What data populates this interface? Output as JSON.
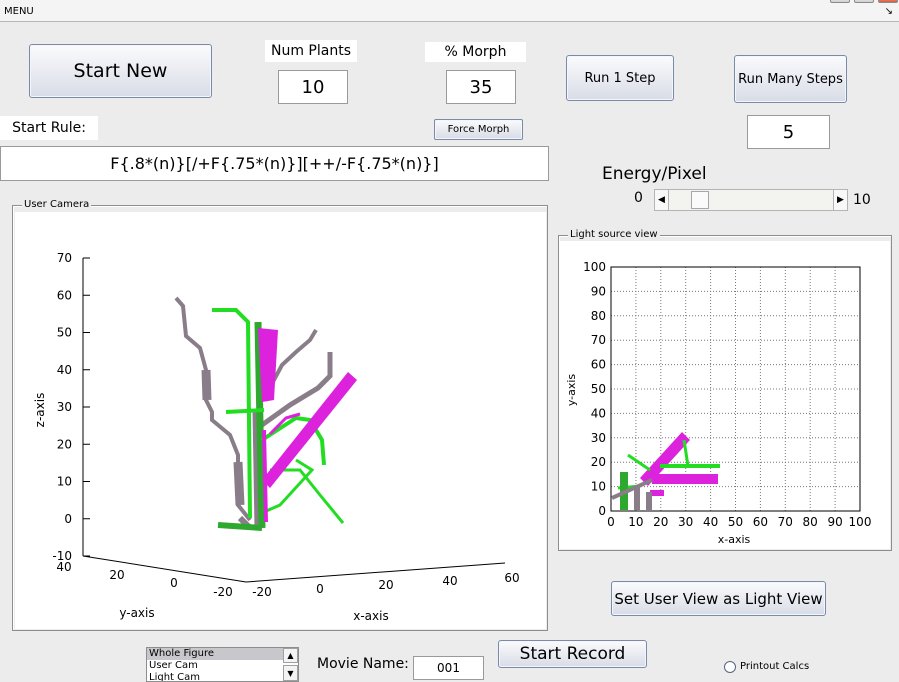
{
  "menu": {
    "label": "MENU",
    "corner_glyph": "↘"
  },
  "controls": {
    "start_new": "Start New",
    "num_plants": {
      "label": "Num Plants",
      "value": "10"
    },
    "morph": {
      "label": "% Morph",
      "value": "35"
    },
    "run_1_step": "Run 1 Step",
    "run_many_steps": "Run Many Steps",
    "many_steps_value": "5",
    "start_rule": {
      "label": "Start Rule:",
      "value": "F{.8*(n)}[/+F{.75*(n)}][++/-F{.75*(n)}]"
    },
    "force_morph": "Force Morph",
    "energy": {
      "label": "Energy/Pixel",
      "min": "0",
      "max": "10",
      "value": 1.5
    },
    "set_user_view": "Set User View as Light View",
    "view_list": [
      "Whole Figure",
      "User Cam",
      "Light Cam"
    ],
    "movie_name": {
      "label": "Movie Name:",
      "value": "001"
    },
    "start_record": "Start Record",
    "printout_calcs": "Printout Calcs"
  },
  "user_camera": {
    "title": "User Camera",
    "z_ticks": [
      "70",
      "60",
      "50",
      "40",
      "30",
      "20",
      "10",
      "0",
      "-10"
    ],
    "y_ticks": [
      "40",
      "20",
      "0",
      "-20"
    ],
    "x_ticks": [
      "-20",
      "0",
      "20",
      "40",
      "60"
    ],
    "xlabel": "x-axis",
    "ylabel": "y-axis",
    "zlabel": "z-axis"
  },
  "light_view": {
    "title": "Light source view",
    "ticks": [
      "0",
      "10",
      "20",
      "30",
      "40",
      "50",
      "60",
      "70",
      "80",
      "90",
      "100"
    ],
    "xlabel": "x-axis",
    "ylabel": "y-axis"
  },
  "colors": {
    "green": "#22dd22",
    "magenta": "#dd22dd",
    "gray": "#8a7d8a",
    "darkgreen": "#2fa82f"
  }
}
